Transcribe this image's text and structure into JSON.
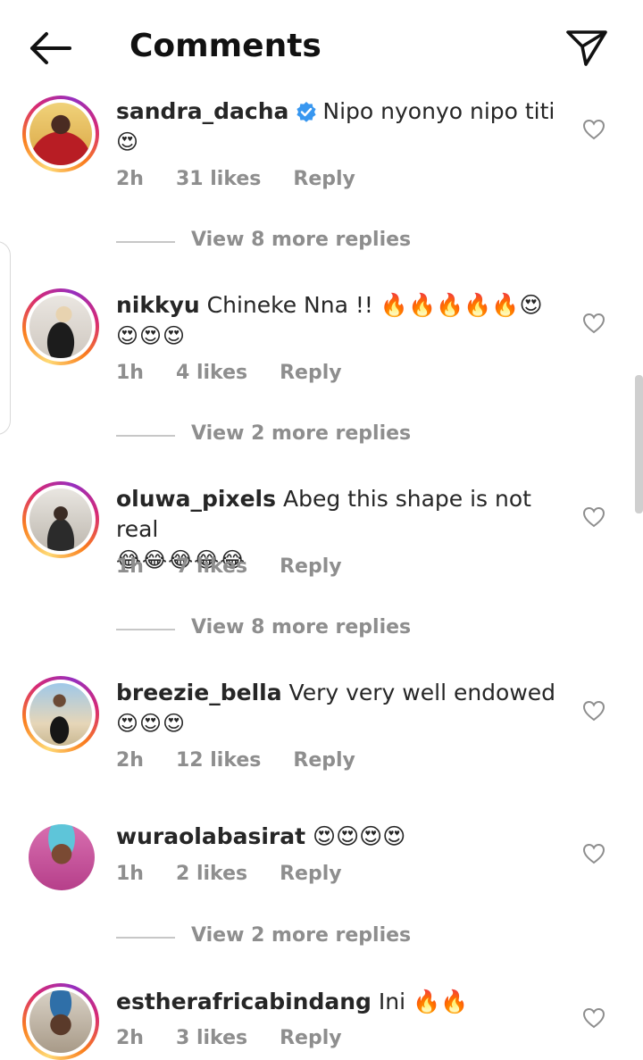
{
  "header": {
    "title": "Comments",
    "back_icon": "arrow-left-icon",
    "send_icon": "paper-plane-icon"
  },
  "comments": [
    {
      "username": "sandra_dacha",
      "verified": true,
      "text": "Nipo nyonyo nipo titi",
      "emoji_line": "😍",
      "time": "2h",
      "likes": "31 likes",
      "reply": "Reply",
      "view_replies": "View 8 more replies"
    },
    {
      "username": "nikkyu",
      "verified": false,
      "text": "Chineke Nna !! 🔥🔥🔥🔥🔥😍",
      "emoji_line": "😍😍😍",
      "time": "1h",
      "likes": "4 likes",
      "reply": "Reply",
      "view_replies": "View 2 more replies"
    },
    {
      "username": "oluwa_pixels",
      "verified": false,
      "text": "Abeg this shape is not real",
      "emoji_line": "😂😂😂😂😂",
      "time": "1h",
      "likes": "7 likes",
      "reply": "Reply",
      "view_replies": "View 8 more replies"
    },
    {
      "username": "breezie_bella",
      "verified": false,
      "text": "Very very well endowed",
      "emoji_line": "😍😍😍",
      "time": "2h",
      "likes": "12 likes",
      "reply": "Reply",
      "view_replies": ""
    },
    {
      "username": "wuraolabasirat",
      "verified": false,
      "text": "😍😍😍😍",
      "emoji_line": "",
      "time": "1h",
      "likes": "2 likes",
      "reply": "Reply",
      "view_replies": "View 2 more replies"
    },
    {
      "username": "estherafricabindang",
      "verified": false,
      "text": "Ini 🔥🔥",
      "emoji_line": "",
      "time": "2h",
      "likes": "3 likes",
      "reply": "Reply",
      "view_replies": ""
    }
  ],
  "colors": {
    "verified": "#3897f0",
    "muted": "#8e8e8e",
    "text": "#262626"
  }
}
